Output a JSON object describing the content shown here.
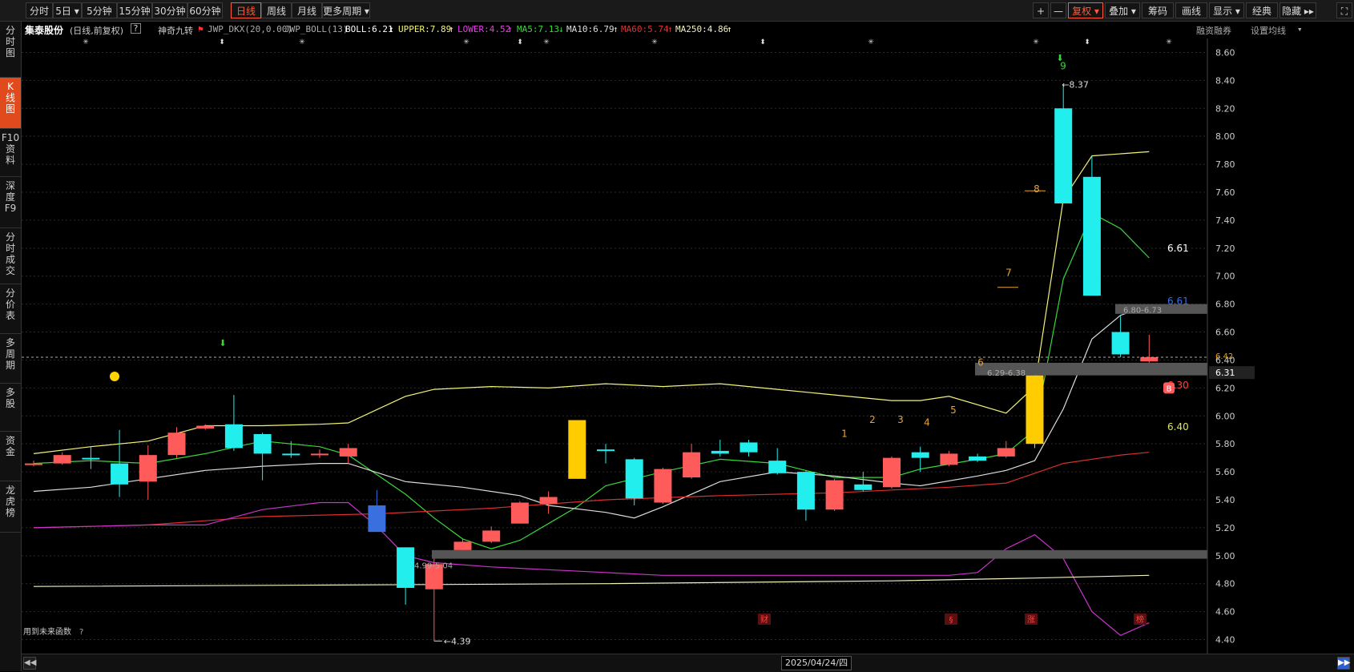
{
  "toolbar": {
    "left_tabs": [
      "分时",
      "5日",
      "5分钟",
      "15分钟",
      "30分钟",
      "60分钟",
      "日线",
      "周线",
      "月线",
      "更多周期"
    ],
    "active_tab": "日线",
    "right_buttons": [
      "+",
      "—",
      "复权",
      "叠加",
      "筹码",
      "画线",
      "显示",
      "经典",
      "隐藏"
    ]
  },
  "left_nav": [
    "分时图",
    "K线图",
    "F10资料",
    "深度F9",
    "分时成交",
    "分价表",
    "多周期",
    "多股",
    "资金",
    "龙虎榜"
  ],
  "left_nav_active": "K线图",
  "info": {
    "stock_name": "集泰股份",
    "mode": "(日线,前复权)",
    "help": "?",
    "indicator": "神奇九转",
    "dkx": "JWP_DKX(20,0.00)",
    "boll_name": "JWP_BOLL(13)",
    "boll": "BOLL:6.21",
    "upper": "UPPER:7.89",
    "lower": "LOWER:4.52",
    "ma5": "MA5:7.13",
    "ma10": "MA10:6.79",
    "ma60": "MA60:5.74",
    "ma250": "MA250:4.86",
    "margin": "融资融券",
    "set_ma": "设置均线"
  },
  "colors": {
    "up": "#ff5b5b",
    "down": "#22eeee",
    "upper": "#f3f37a",
    "ma5": "#39d639",
    "ma10": "#dcdcdc",
    "ma60": "#d92e2e",
    "lower": "#cc33cc",
    "ma250": "#f0f0c0",
    "yellow": "#ffcc00",
    "blue": "#3a6fe0"
  },
  "annotations": {
    "low_value": "4.39",
    "high_value": "8.37",
    "zone_low": "4.99-5.04",
    "zone_mid": "6.29-6.38",
    "zone_top": "6.80-6.73",
    "r661a": "6.61",
    "r661b": "6.61",
    "r642": "6.42",
    "r631": "6.31",
    "r630": "6.30",
    "r640": "6.40",
    "b_badge": "B",
    "future_func": "用到未来函数",
    "future_q": "?",
    "footer_date": "2025/04/24/四",
    "footer_tags": [
      "财",
      "§",
      "涨",
      "榜"
    ],
    "nine_turn": [
      "1",
      "2",
      "3",
      "4",
      "5",
      "6",
      "7",
      "8",
      "9"
    ]
  },
  "chart_data": {
    "type": "candlestick",
    "ylim": [
      4.3,
      8.7
    ],
    "y_ticks": [
      "8.60",
      "8.40",
      "8.20",
      "8.00",
      "7.80",
      "7.60",
      "7.40",
      "7.20",
      "7.00",
      "6.80",
      "6.60",
      "6.40",
      "6.20",
      "6.00",
      "5.80",
      "5.60",
      "5.40",
      "5.20",
      "5.00",
      "4.80",
      "4.60",
      "4.40"
    ],
    "current_price": "6.31",
    "candles": [
      {
        "o": 5.66,
        "c": 5.66,
        "h": 5.68,
        "l": 5.64
      },
      {
        "o": 5.66,
        "c": 5.72,
        "h": 5.74,
        "l": 5.65
      },
      {
        "o": 5.7,
        "c": 5.69,
        "h": 5.78,
        "l": 5.62
      },
      {
        "o": 5.66,
        "c": 5.51,
        "h": 5.9,
        "l": 5.42
      },
      {
        "o": 5.53,
        "c": 5.72,
        "h": 5.79,
        "l": 5.4
      },
      {
        "o": 5.72,
        "c": 5.88,
        "h": 5.92,
        "l": 5.7
      },
      {
        "o": 5.91,
        "c": 5.93,
        "h": 5.94,
        "l": 5.9
      },
      {
        "o": 5.94,
        "c": 5.77,
        "h": 6.15,
        "l": 5.75
      },
      {
        "o": 5.87,
        "c": 5.73,
        "h": 5.88,
        "l": 5.54
      },
      {
        "o": 5.73,
        "c": 5.72,
        "h": 5.82,
        "l": 5.7
      },
      {
        "o": 5.73,
        "c": 5.73,
        "h": 5.76,
        "l": 5.7
      },
      {
        "o": 5.71,
        "c": 5.77,
        "h": 5.8,
        "l": 5.66
      },
      {
        "o": 5.36,
        "c": 5.17,
        "h": 5.47,
        "l": 5.17
      },
      {
        "o": 5.06,
        "c": 4.77,
        "h": 5.06,
        "l": 4.65
      },
      {
        "o": 4.76,
        "c": 4.94,
        "h": 5.02,
        "l": 4.39
      },
      {
        "o": 5.04,
        "c": 5.1,
        "h": 5.12,
        "l": 5.0
      },
      {
        "o": 5.1,
        "c": 5.18,
        "h": 5.21,
        "l": 5.09
      },
      {
        "o": 5.23,
        "c": 5.38,
        "h": 5.39,
        "l": 5.23
      },
      {
        "o": 5.37,
        "c": 5.42,
        "h": 5.46,
        "l": 5.3
      },
      {
        "o": 5.97,
        "c": 5.55,
        "h": 5.97,
        "l": 5.55
      },
      {
        "o": 5.76,
        "c": 5.75,
        "h": 5.8,
        "l": 5.66
      },
      {
        "o": 5.69,
        "c": 5.41,
        "h": 5.7,
        "l": 5.36
      },
      {
        "o": 5.38,
        "c": 5.62,
        "h": 5.63,
        "l": 5.37
      },
      {
        "o": 5.56,
        "c": 5.74,
        "h": 5.8,
        "l": 5.55
      },
      {
        "o": 5.75,
        "c": 5.73,
        "h": 5.83,
        "l": 5.71
      },
      {
        "o": 5.81,
        "c": 5.74,
        "h": 5.83,
        "l": 5.71
      },
      {
        "o": 5.68,
        "c": 5.59,
        "h": 5.77,
        "l": 5.58
      },
      {
        "o": 5.6,
        "c": 5.33,
        "h": 5.61,
        "l": 5.25
      },
      {
        "o": 5.33,
        "c": 5.54,
        "h": 5.55,
        "l": 5.32
      },
      {
        "o": 5.51,
        "c": 5.47,
        "h": 5.6,
        "l": 5.46
      },
      {
        "o": 5.49,
        "c": 5.7,
        "h": 5.71,
        "l": 5.48
      },
      {
        "o": 5.74,
        "c": 5.7,
        "h": 5.78,
        "l": 5.6
      },
      {
        "o": 5.65,
        "c": 5.73,
        "h": 5.75,
        "l": 5.64
      },
      {
        "o": 5.71,
        "c": 5.68,
        "h": 5.73,
        "l": 5.67
      },
      {
        "o": 5.71,
        "c": 5.77,
        "h": 5.82,
        "l": 5.7
      },
      {
        "o": 5.8,
        "c": 6.29,
        "h": 6.29,
        "l": 5.77
      },
      {
        "o": 8.2,
        "c": 7.52,
        "h": 8.37,
        "l": 7.52
      },
      {
        "o": 7.71,
        "c": 6.86,
        "h": 7.86,
        "l": 6.86
      },
      {
        "o": 6.6,
        "c": 6.44,
        "h": 6.72,
        "l": 6.42
      },
      {
        "o": 6.39,
        "c": 6.42,
        "h": 6.58,
        "l": 6.38
      }
    ],
    "lines": {
      "upper": [
        [
          0,
          5.73
        ],
        [
          2,
          5.78
        ],
        [
          4,
          5.82
        ],
        [
          6,
          5.93
        ],
        [
          8,
          5.93
        ],
        [
          10,
          5.94
        ],
        [
          11,
          5.95
        ],
        [
          13,
          6.14
        ],
        [
          14,
          6.19
        ],
        [
          16,
          6.21
        ],
        [
          18,
          6.2
        ],
        [
          20,
          6.23
        ],
        [
          22,
          6.21
        ],
        [
          24,
          6.23
        ],
        [
          26,
          6.19
        ],
        [
          28,
          6.15
        ],
        [
          30,
          6.11
        ],
        [
          31,
          6.11
        ],
        [
          32,
          6.14
        ],
        [
          34,
          6.02
        ],
        [
          35,
          6.21
        ],
        [
          36,
          7.55
        ],
        [
          37,
          7.86
        ],
        [
          39,
          7.89
        ]
      ],
      "ma5": [
        [
          0,
          5.66
        ],
        [
          2,
          5.68
        ],
        [
          4,
          5.66
        ],
        [
          6,
          5.73
        ],
        [
          8,
          5.82
        ],
        [
          10,
          5.78
        ],
        [
          11,
          5.72
        ],
        [
          13,
          5.44
        ],
        [
          14,
          5.27
        ],
        [
          15,
          5.12
        ],
        [
          16,
          5.05
        ],
        [
          17,
          5.11
        ],
        [
          18,
          5.23
        ],
        [
          19,
          5.35
        ],
        [
          20,
          5.5
        ],
        [
          22,
          5.6
        ],
        [
          24,
          5.69
        ],
        [
          26,
          5.66
        ],
        [
          28,
          5.56
        ],
        [
          30,
          5.56
        ],
        [
          31,
          5.62
        ],
        [
          33,
          5.69
        ],
        [
          34,
          5.73
        ],
        [
          35,
          5.9
        ],
        [
          36,
          6.98
        ],
        [
          37,
          7.45
        ],
        [
          38,
          7.34
        ],
        [
          39,
          7.13
        ]
      ],
      "ma10": [
        [
          0,
          5.46
        ],
        [
          2,
          5.49
        ],
        [
          4,
          5.55
        ],
        [
          6,
          5.61
        ],
        [
          8,
          5.64
        ],
        [
          10,
          5.66
        ],
        [
          11,
          5.66
        ],
        [
          13,
          5.53
        ],
        [
          15,
          5.49
        ],
        [
          17,
          5.43
        ],
        [
          18,
          5.36
        ],
        [
          20,
          5.31
        ],
        [
          21,
          5.27
        ],
        [
          22,
          5.35
        ],
        [
          24,
          5.53
        ],
        [
          26,
          5.6
        ],
        [
          28,
          5.57
        ],
        [
          30,
          5.52
        ],
        [
          31,
          5.5
        ],
        [
          33,
          5.57
        ],
        [
          34,
          5.61
        ],
        [
          35,
          5.68
        ],
        [
          36,
          6.05
        ],
        [
          37,
          6.55
        ],
        [
          38,
          6.72
        ],
        [
          39,
          6.79
        ]
      ],
      "ma60": [
        [
          0,
          5.2
        ],
        [
          4,
          5.22
        ],
        [
          8,
          5.28
        ],
        [
          12,
          5.3
        ],
        [
          16,
          5.34
        ],
        [
          20,
          5.4
        ],
        [
          24,
          5.43
        ],
        [
          28,
          5.45
        ],
        [
          30,
          5.47
        ],
        [
          32,
          5.49
        ],
        [
          34,
          5.52
        ],
        [
          36,
          5.66
        ],
        [
          38,
          5.72
        ],
        [
          39,
          5.74
        ]
      ],
      "lower": [
        [
          0,
          5.2
        ],
        [
          2,
          5.21
        ],
        [
          4,
          5.22
        ],
        [
          6,
          5.22
        ],
        [
          8,
          5.33
        ],
        [
          10,
          5.38
        ],
        [
          11,
          5.38
        ],
        [
          12,
          5.21
        ],
        [
          13,
          5.0
        ],
        [
          14,
          4.95
        ],
        [
          16,
          4.92
        ],
        [
          18,
          4.9
        ],
        [
          20,
          4.88
        ],
        [
          22,
          4.86
        ],
        [
          24,
          4.86
        ],
        [
          26,
          4.86
        ],
        [
          28,
          4.86
        ],
        [
          30,
          4.86
        ],
        [
          32,
          4.86
        ],
        [
          33,
          4.88
        ],
        [
          34,
          5.05
        ],
        [
          35,
          5.15
        ],
        [
          36,
          4.98
        ],
        [
          37,
          4.6
        ],
        [
          38,
          4.43
        ],
        [
          39,
          4.52
        ]
      ],
      "ma250": [
        [
          0,
          4.78
        ],
        [
          10,
          4.79
        ],
        [
          20,
          4.8
        ],
        [
          30,
          4.82
        ],
        [
          35,
          4.84
        ],
        [
          39,
          4.86
        ]
      ]
    }
  }
}
